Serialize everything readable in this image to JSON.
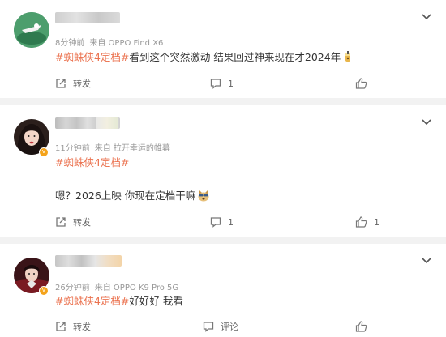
{
  "posts": [
    {
      "meta_time": "8分钟前",
      "meta_source": "来自 OPPO Find X6",
      "topic": "#蜘蛛侠4定档#",
      "text": "看到这个突然激动 结果回过神来现在才2024年",
      "repost_label": "转发",
      "comment_count": "1",
      "like_count": ""
    },
    {
      "meta_time": "11分钟前",
      "meta_source": "来自 拉开幸运的帷幕",
      "topic": "#蜘蛛侠4定档#",
      "text": "嗯？2026上映 你现在定档干嘛",
      "repost_label": "转发",
      "comment_count": "1",
      "like_count": "1"
    },
    {
      "meta_time": "26分钟前",
      "meta_source": "来自 OPPO K9 Pro 5G",
      "topic": "#蜘蛛侠4定档#",
      "text": "好好好 我看",
      "repost_label": "转发",
      "comment_label": "评论",
      "like_count": ""
    }
  ],
  "icons": {
    "repost": "repost-icon",
    "comment": "comment-icon",
    "like": "thumbs-up-icon",
    "menu": "chevron-down-icon",
    "emoji1": "drink-emoji-icon",
    "emoji2": "doge-emoji-icon"
  },
  "colors": {
    "topic": "#eb7350",
    "meta": "#999999",
    "verified_badge": "#f4a31b"
  }
}
